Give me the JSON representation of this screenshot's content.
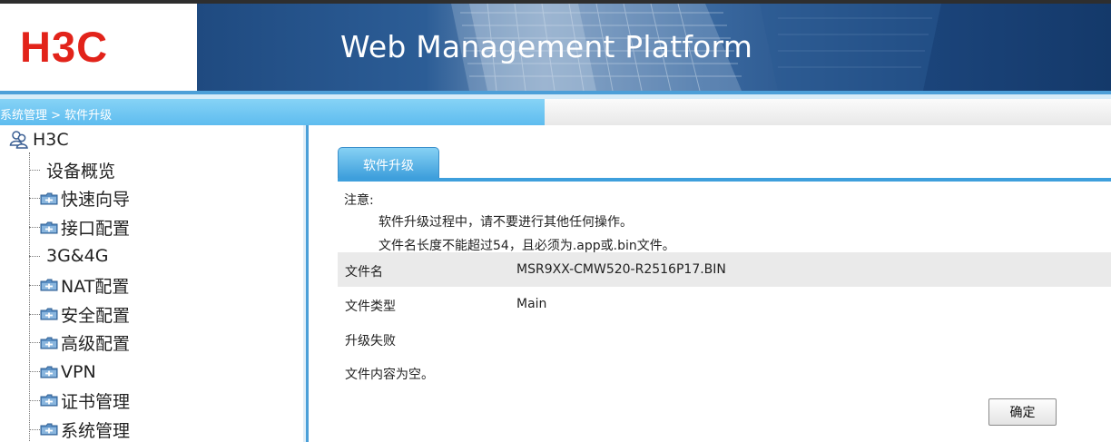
{
  "header": {
    "logo_text": "H3C",
    "title": "Web Management Platform"
  },
  "breadcrumb": {
    "text": "系统管理 > 软件升级"
  },
  "sidebar": {
    "root_label": "H3C",
    "items": [
      {
        "label": "设备概览",
        "has_folder": false
      },
      {
        "label": "快速向导",
        "has_folder": true
      },
      {
        "label": "接口配置",
        "has_folder": true
      },
      {
        "label": "3G&4G",
        "has_folder": false
      },
      {
        "label": "NAT配置",
        "has_folder": true
      },
      {
        "label": "安全配置",
        "has_folder": true
      },
      {
        "label": "高级配置",
        "has_folder": true
      },
      {
        "label": "VPN",
        "has_folder": true
      },
      {
        "label": "证书管理",
        "has_folder": true
      },
      {
        "label": "系统管理",
        "has_folder": true
      }
    ]
  },
  "main": {
    "tab_label": "软件升级",
    "notice": {
      "title": "注意:",
      "lines": [
        "软件升级过程中，请不要进行其他任何操作。",
        "文件名长度不能超过54，且必须为.app或.bin文件。"
      ]
    },
    "fields": [
      {
        "key": "文件名",
        "value": "MSR9XX-CMW520-R2516P17.BIN"
      },
      {
        "key": "文件类型",
        "value": "Main"
      }
    ],
    "result_status": "升级失败",
    "result_message": "文件内容为空。",
    "ok_button": "确定"
  },
  "colors": {
    "brand_red": "#e2231a",
    "accent_blue": "#3e9fdc",
    "breadcrumb_blue": "#5ebcef",
    "header_navy": "#1f4a80"
  },
  "icons": {
    "root": "users-icon",
    "folder": "folder-icon"
  }
}
